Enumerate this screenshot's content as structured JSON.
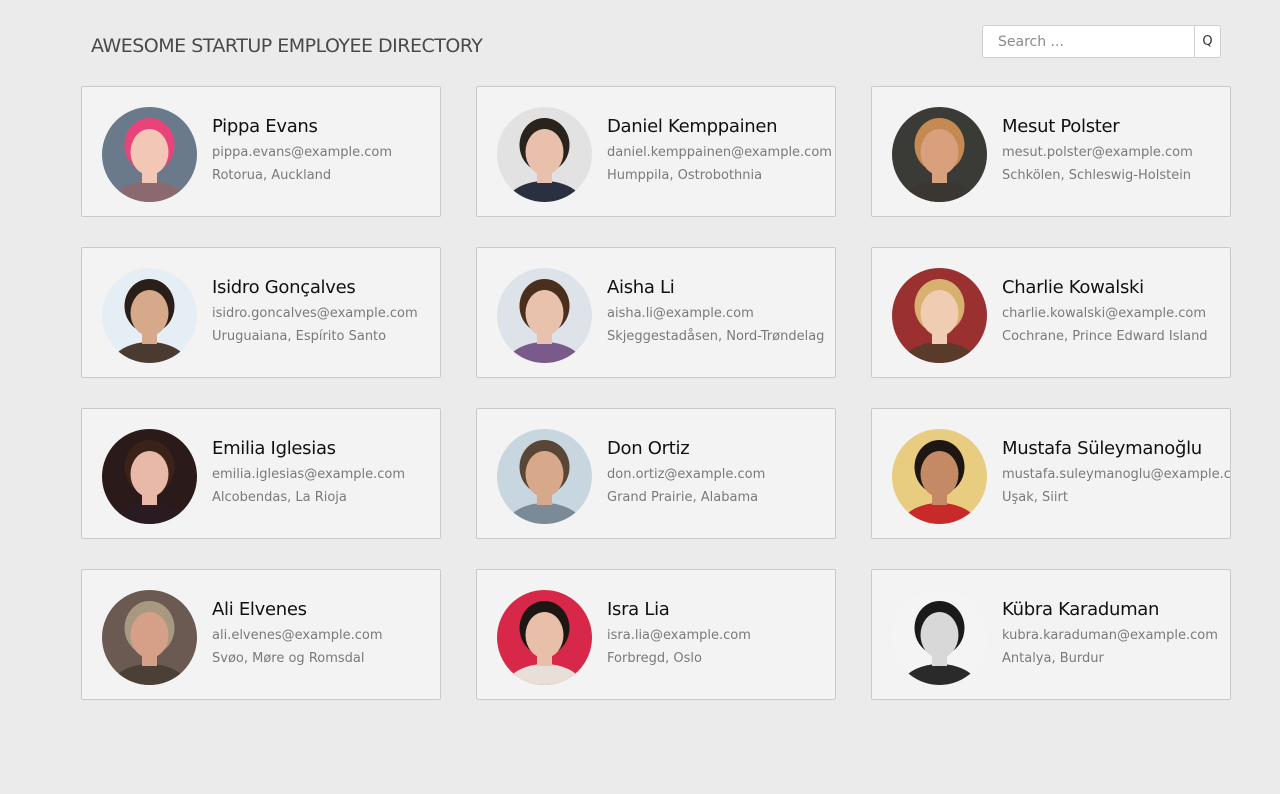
{
  "header": {
    "title": "AWESOME STARTUP EMPLOYEE DIRECTORY"
  },
  "search": {
    "placeholder": "Search ...",
    "button_label": "Q"
  },
  "employees": [
    {
      "name": "Pippa Evans",
      "email": "pippa.evans@example.com",
      "location": "Rotorua, Auckland",
      "avatar": {
        "bg": "#6a7a8a",
        "skin": "#f2c7b5",
        "hair": "#e8447a",
        "shirt": "#8a6a70"
      }
    },
    {
      "name": "Daniel Kemppainen",
      "email": "daniel.kemppainen@example.com",
      "location": "Humppila, Ostrobothnia",
      "avatar": {
        "bg": "#e2e2e2",
        "skin": "#e8c0ac",
        "hair": "#2a221c",
        "shirt": "#2a3040"
      }
    },
    {
      "name": "Mesut Polster",
      "email": "mesut.polster@example.com",
      "location": "Schkölen, Schleswig-Holstein",
      "avatar": {
        "bg": "#3a3a36",
        "skin": "#d9a07e",
        "hair": "#c48a52",
        "shirt": "#3a3632"
      }
    },
    {
      "name": "Isidro Gonçalves",
      "email": "isidro.goncalves@example.com",
      "location": "Uruguaiana, Espírito Santo",
      "avatar": {
        "bg": "#e6eef5",
        "skin": "#d6a98a",
        "hair": "#2a1e18",
        "shirt": "#4a3a30"
      }
    },
    {
      "name": "Aisha Li",
      "email": "aisha.li@example.com",
      "location": "Skjeggestadåsen, Nord-Trøndelag",
      "avatar": {
        "bg": "#dde3e8",
        "skin": "#e8c2ad",
        "hair": "#4a2e1e",
        "shirt": "#7a5a8a"
      }
    },
    {
      "name": "Charlie Kowalski",
      "email": "charlie.kowalski@example.com",
      "location": "Cochrane, Prince Edward Island",
      "avatar": {
        "bg": "#9a3030",
        "skin": "#f0cdb2",
        "hair": "#d8b070",
        "shirt": "#5a3a2a"
      }
    },
    {
      "name": "Emilia Iglesias",
      "email": "emilia.iglesias@example.com",
      "location": "Alcobendas, La Rioja",
      "avatar": {
        "bg": "#2a1a1a",
        "skin": "#e8b8a8",
        "hair": "#3a2218",
        "shirt": "#2a1a22"
      }
    },
    {
      "name": "Don Ortiz",
      "email": "don.ortiz@example.com",
      "location": "Grand Prairie, Alabama",
      "avatar": {
        "bg": "#c8d6df",
        "skin": "#d8a88a",
        "hair": "#5a4636",
        "shirt": "#7a8a96"
      }
    },
    {
      "name": "Mustafa Süleymanoğlu",
      "email": "mustafa.suleymanoglu@example.com",
      "location": "Uşak, Siirt",
      "avatar": {
        "bg": "#e8cc80",
        "skin": "#c48a66",
        "hair": "#1e1612",
        "shirt": "#c82a2a"
      }
    },
    {
      "name": "Ali Elvenes",
      "email": "ali.elvenes@example.com",
      "location": "Svøo, Møre og Romsdal",
      "avatar": {
        "bg": "#6a5a52",
        "skin": "#d6a088",
        "hair": "#a89880",
        "shirt": "#4a4038"
      }
    },
    {
      "name": "Isra Lia",
      "email": "isra.lia@example.com",
      "location": "Forbregd, Oslo",
      "avatar": {
        "bg": "#d8284a",
        "skin": "#e8bfa8",
        "hair": "#1e1614",
        "shirt": "#e8e0d8"
      }
    },
    {
      "name": "Kübra Karaduman",
      "email": "kubra.karaduman@example.com",
      "location": "Antalya, Burdur",
      "avatar": {
        "bg": "#f4f4f4",
        "skin": "#d8d8d8",
        "hair": "#1a1a1a",
        "shirt": "#2a2a2a"
      }
    }
  ]
}
